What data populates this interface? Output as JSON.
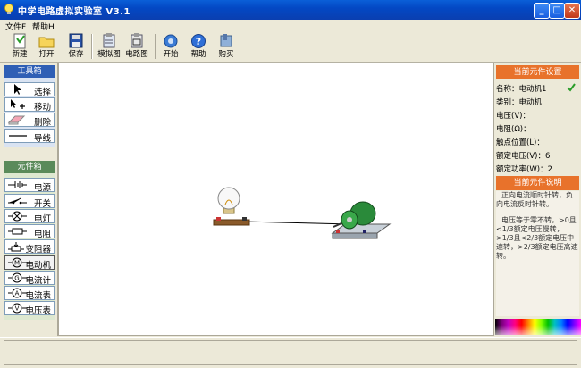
{
  "window": {
    "title": "中学电路虚拟实验室 V3.1"
  },
  "menu": [
    {
      "label": "文件F"
    },
    {
      "label": "帮助H"
    }
  ],
  "toolbar": [
    {
      "label": "新建",
      "icon": "new-icon"
    },
    {
      "label": "打开",
      "icon": "open-folder-icon"
    },
    {
      "label": "保存",
      "icon": "save-disk-icon"
    },
    {
      "label": "模拟图",
      "icon": "simulation-view-icon"
    },
    {
      "label": "电路图",
      "icon": "circuit-diagram-icon"
    },
    {
      "label": "开始",
      "icon": "start-gear-icon"
    },
    {
      "label": "帮助",
      "icon": "help-icon"
    },
    {
      "label": "购买",
      "icon": "buy-icon"
    }
  ],
  "toolbox": {
    "title": "工具箱",
    "items": [
      {
        "label": "选择",
        "icon": "select-arrow-icon"
      },
      {
        "label": "移动",
        "icon": "move-arrow-icon"
      },
      {
        "label": "删除",
        "icon": "eraser-icon"
      },
      {
        "label": "导线",
        "icon": "wire-line-icon"
      }
    ]
  },
  "components": {
    "title": "元件箱",
    "items": [
      {
        "label": "电源",
        "icon": "battery-symbol-icon"
      },
      {
        "label": "开关",
        "icon": "switch-symbol-icon"
      },
      {
        "label": "电灯",
        "icon": "lamp-symbol-icon"
      },
      {
        "label": "电阻",
        "icon": "resistor-symbol-icon"
      },
      {
        "label": "变阻器",
        "icon": "rheostat-symbol-icon"
      },
      {
        "label": "电动机",
        "icon": "motor-symbol-icon"
      },
      {
        "label": "电流计",
        "icon": "galvanometer-symbol-icon"
      },
      {
        "label": "电流表",
        "icon": "ammeter-symbol-icon"
      },
      {
        "label": "电压表",
        "icon": "voltmeter-symbol-icon"
      }
    ],
    "selected_index": 5
  },
  "properties": {
    "title": "当前元件设置",
    "rows": [
      {
        "text": "名称：电动机1"
      },
      {
        "text": "类别：电动机"
      },
      {
        "text": "电压(V)："
      },
      {
        "text": "电阻(Ω)："
      },
      {
        "text": "触点位置(L)："
      },
      {
        "text": "额定电压(V)：6"
      },
      {
        "text": "额定功率(W)：2"
      }
    ],
    "check_icon": "checkmark-icon"
  },
  "description": {
    "title": "当前元件说明",
    "paragraphs": [
      "正向电流顺时针转，负向电流反时针转。",
      "电压等于零不转，>0且<1/3额定电压慢转，>1/3且<2/3额定电压中速转，>2/3额定电压高速转。"
    ]
  },
  "colors": {
    "panel_head_blue": "#2f5fb5",
    "panel_head_green": "#5a8a5a",
    "accent_orange": "#e8722b"
  }
}
